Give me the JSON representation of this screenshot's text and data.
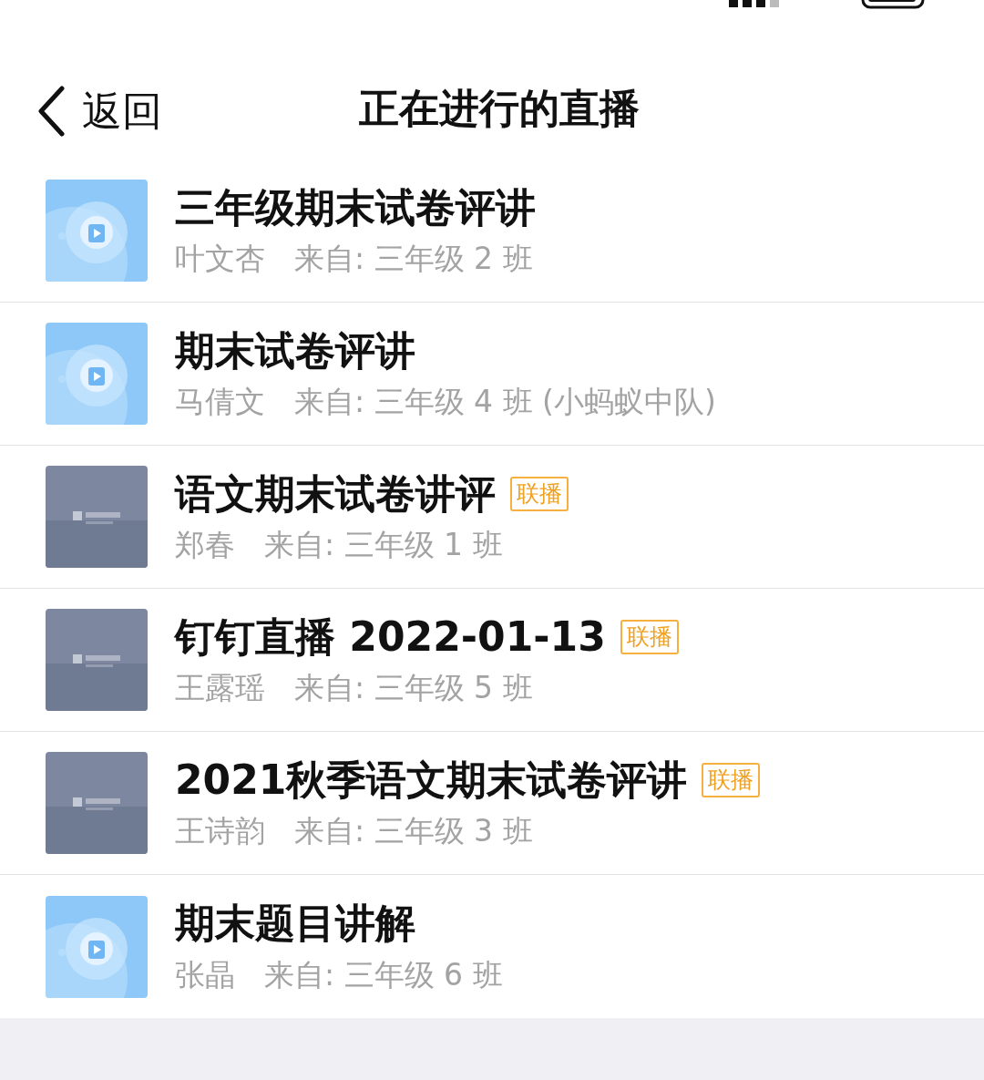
{
  "header": {
    "back_label": "返回",
    "title": "正在进行的直播"
  },
  "items": [
    {
      "title": "三年级期末试卷评讲",
      "teacher": "叶文杏",
      "source": "来自: 三年级 2 班",
      "color": "#8ec8f8"
    },
    {
      "title": "期末试卷评讲",
      "teacher": "马倩文",
      "source": "来自: 三年级 4 班 (小蚂蚁中队)",
      "color": "#8ec8f8"
    },
    {
      "title": "语文期末试卷讲评",
      "badge": "联播",
      "teacher": "郑春",
      "source": "来自: 三年级 1 班",
      "color": "#7d87a0"
    },
    {
      "title": "钉钉直播 2022-01-13",
      "badge": "联播",
      "teacher": "王露瑶",
      "source": "来自: 三年级 5 班",
      "color": "#7d87a0"
    },
    {
      "title": "2021秋季语文期末试卷评讲",
      "badge": "联播",
      "teacher": "王诗韵",
      "source": "来自: 三年级 3 班",
      "color": "#7d87a0"
    },
    {
      "title": "期末题目讲解",
      "teacher": "张晶",
      "source": "来自: 三年级 6 班",
      "color": "#8ec8f8"
    }
  ]
}
